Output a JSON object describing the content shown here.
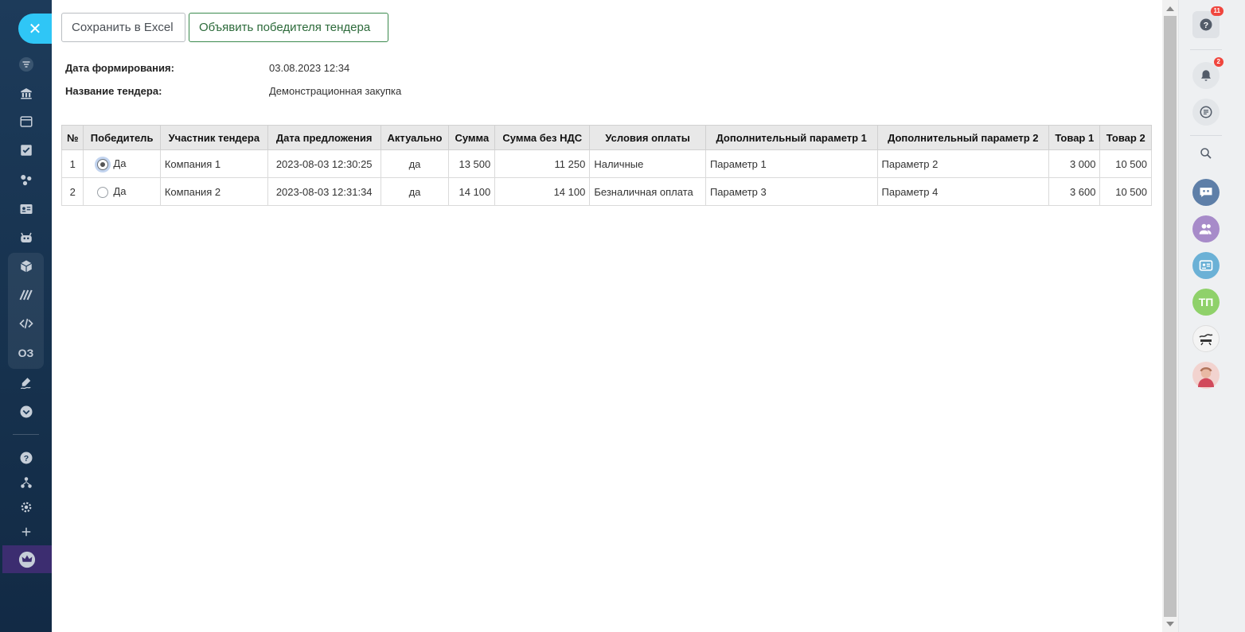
{
  "left_sidebar": {
    "close_icon": "close-icon",
    "items": [
      {
        "name": "filter-icon"
      },
      {
        "name": "bank-icon"
      },
      {
        "name": "window-icon"
      },
      {
        "name": "tasks-icon"
      },
      {
        "name": "crm-icon"
      },
      {
        "name": "contact-card-icon"
      },
      {
        "name": "robot-icon"
      },
      {
        "name": "cube-icon"
      },
      {
        "name": "marketing-icon"
      },
      {
        "name": "code-icon"
      },
      {
        "name": "oz-icon",
        "label": "ОЗ"
      },
      {
        "name": "signature-icon"
      },
      {
        "name": "more-icon"
      },
      {
        "name": "help-icon"
      },
      {
        "name": "structure-icon"
      },
      {
        "name": "settings-icon"
      },
      {
        "name": "add-icon"
      },
      {
        "name": "crown-icon"
      }
    ]
  },
  "toolbar": {
    "excel_label": "Сохранить в Excel",
    "winner_label": "Объявить победителя тендера"
  },
  "info": {
    "date_label": "Дата формирования:",
    "date_value": "03.08.2023 12:34",
    "name_label": "Название тендера:",
    "name_value": "Демонстрационная закупка"
  },
  "table": {
    "headers": [
      "№",
      "Победитель",
      "Участник тендера",
      "Дата предложения",
      "Актуально",
      "Сумма",
      "Сумма без НДС",
      "Условия оплаты",
      "Дополнительный параметр 1",
      "Дополнительный параметр 2",
      "Товар 1",
      "Товар 2"
    ],
    "rows": [
      {
        "num": "1",
        "winner": "Да",
        "winner_selected": true,
        "participant": "Компания 1",
        "date": "2023-08-03 12:30:25",
        "actual": "да",
        "sum": "13 500",
        "sum_no_vat": "11 250",
        "payment": "Наличные",
        "param1": "Параметр 1",
        "param2": "Параметр 2",
        "item1": "3 000",
        "item2": "10 500"
      },
      {
        "num": "2",
        "winner": "Да",
        "winner_selected": false,
        "participant": "Компания 2",
        "date": "2023-08-03 12:31:34",
        "actual": "да",
        "sum": "14 100",
        "sum_no_vat": "14 100",
        "payment": "Безналичная оплата",
        "param1": "Параметр 3",
        "param2": "Параметр 4",
        "item1": "3 600",
        "item2": "10 500"
      }
    ]
  },
  "right_sidebar": {
    "help_badge": "11",
    "notifications_badge": "2",
    "avatar_tp": "ТП"
  },
  "colors": {
    "accent": "#2fc6f6",
    "winner_button": "#3b8a4d",
    "badge": "#f0463e"
  }
}
